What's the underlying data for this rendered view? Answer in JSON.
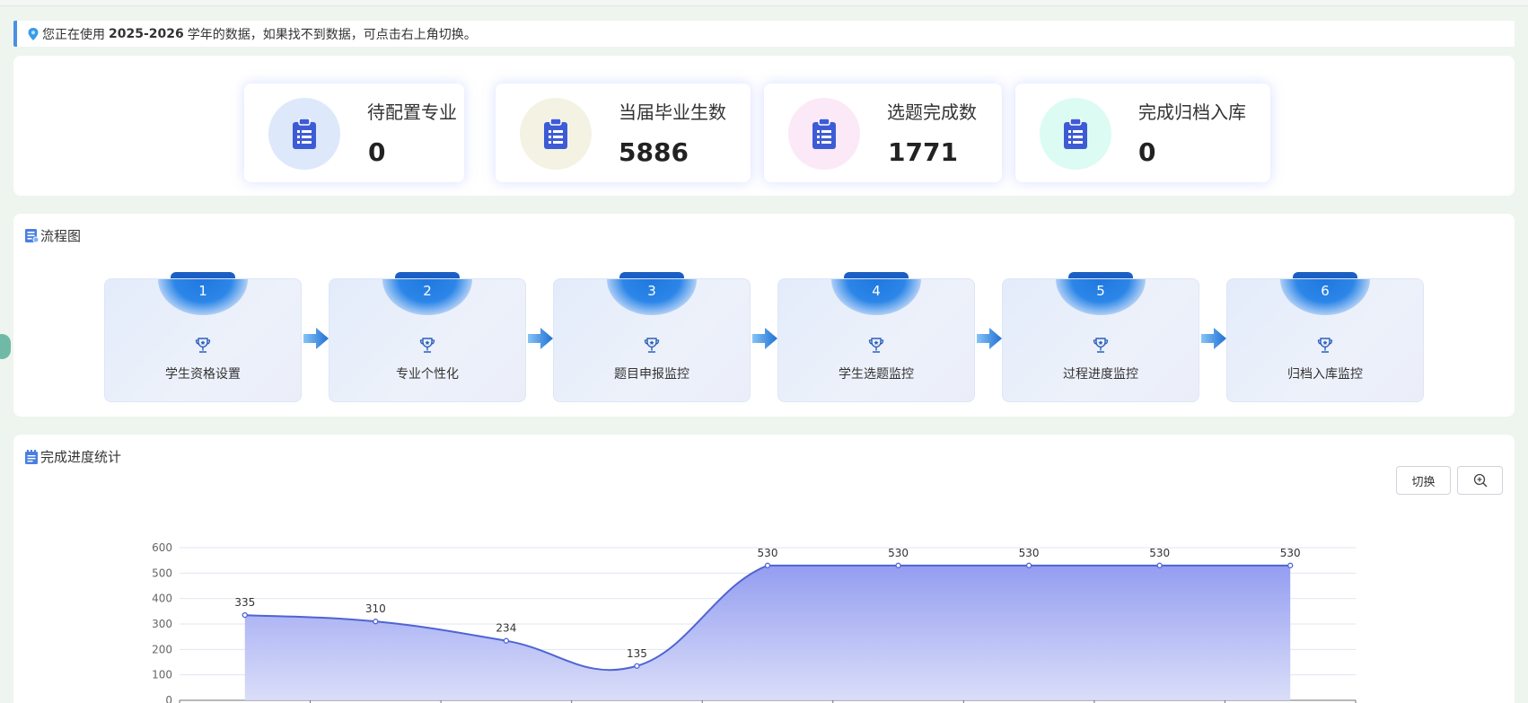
{
  "notice": {
    "prefix": "您正在使用",
    "year": "2025-2026",
    "suffix": "学年的数据，如果找不到数据，可点击右上角切换。"
  },
  "stats": [
    {
      "label": "待配置专业",
      "value": "0",
      "circle_color": "#dde8fb",
      "icon": "clipboard-icon"
    },
    {
      "label": "当届毕业生数",
      "value": "5886",
      "circle_color": "#f4f2e3",
      "icon": "clipboard-icon"
    },
    {
      "label": "选题完成数",
      "value": "1771",
      "circle_color": "#fbe9f7",
      "icon": "clipboard-icon"
    },
    {
      "label": "完成归档入库",
      "value": "0",
      "circle_color": "#dcfbf3",
      "icon": "clipboard-icon"
    }
  ],
  "flow": {
    "title": "流程图",
    "steps": [
      {
        "num": "1",
        "label": "学生资格设置"
      },
      {
        "num": "2",
        "label": "专业个性化"
      },
      {
        "num": "3",
        "label": "题目申报监控"
      },
      {
        "num": "4",
        "label": "学生选题监控"
      },
      {
        "num": "5",
        "label": "过程进度监控"
      },
      {
        "num": "6",
        "label": "归档入库监控"
      }
    ]
  },
  "progress": {
    "title": "完成进度统计",
    "switch_label": "切换",
    "zoom_icon": "zoom-in-icon"
  },
  "colors": {
    "accent": "#4a90e2",
    "icon_blue": "#3e5bd6",
    "line": "#4f64d4",
    "area_top": "#8e98f0"
  },
  "chart_data": {
    "type": "area",
    "ylim": [
      0,
      600
    ],
    "yticks": [
      "0",
      "100",
      "200",
      "300",
      "400",
      "500",
      "600"
    ],
    "values": [
      335,
      310,
      234,
      135,
      530,
      530,
      530,
      530,
      530
    ],
    "data_labels": [
      "335",
      "310",
      "234",
      "135",
      "530",
      "530",
      "530",
      "530",
      "530"
    ],
    "grid": true,
    "smooth": true
  }
}
